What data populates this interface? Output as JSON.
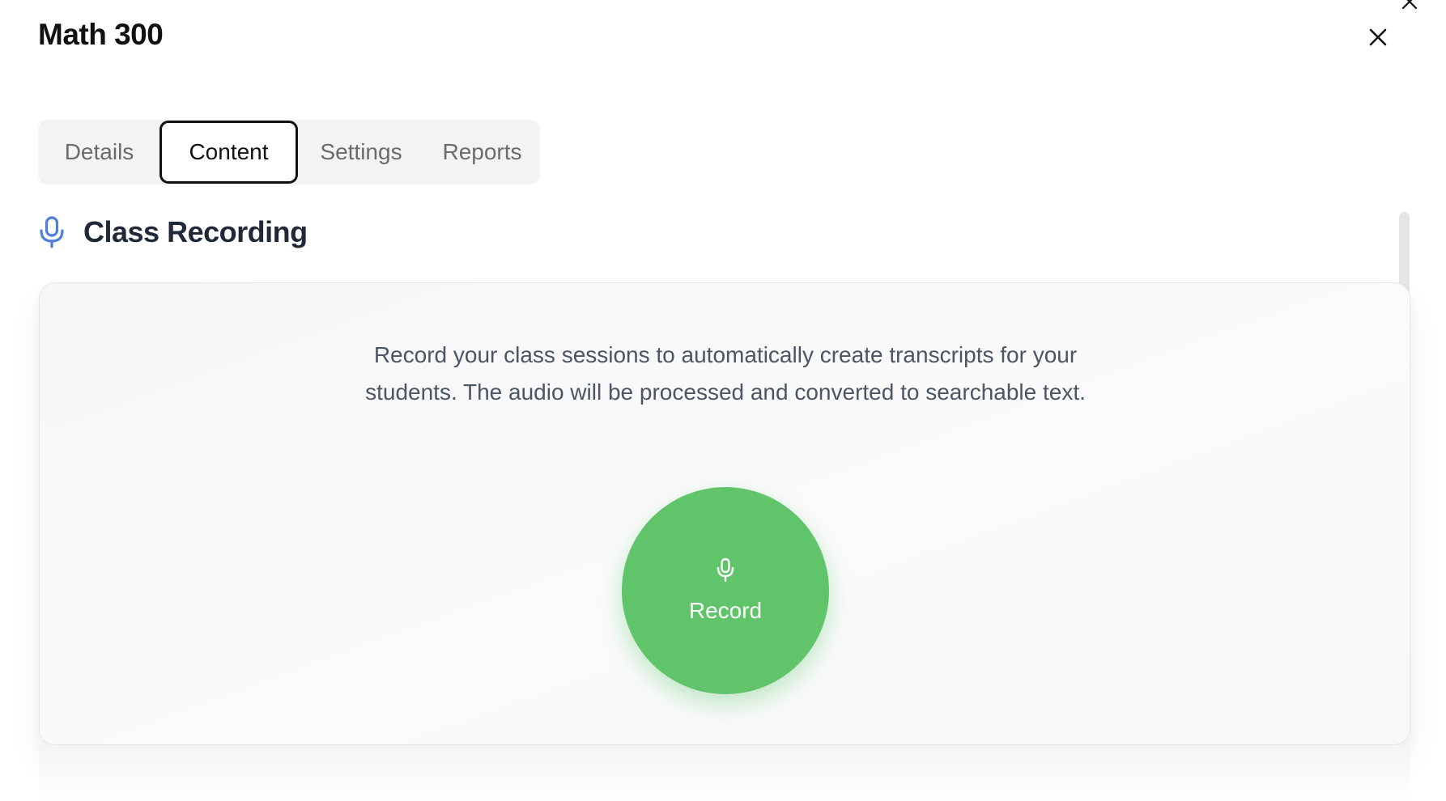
{
  "dialog": {
    "title": "Math 300"
  },
  "tabs": [
    {
      "label": "Details"
    },
    {
      "label": "Content",
      "active": true
    },
    {
      "label": "Settings"
    },
    {
      "label": "Reports"
    }
  ],
  "section": {
    "title": "Class Recording",
    "icon": "microphone-icon"
  },
  "recording": {
    "description": "Record your class sessions to automatically create transcripts for your students. The audio will be processed and converted to searchable text.",
    "button_label": "Record",
    "button_icon": "microphone-icon"
  },
  "colors": {
    "accent_green": "#5fc46a",
    "icon_blue": "#4f7fd9"
  }
}
